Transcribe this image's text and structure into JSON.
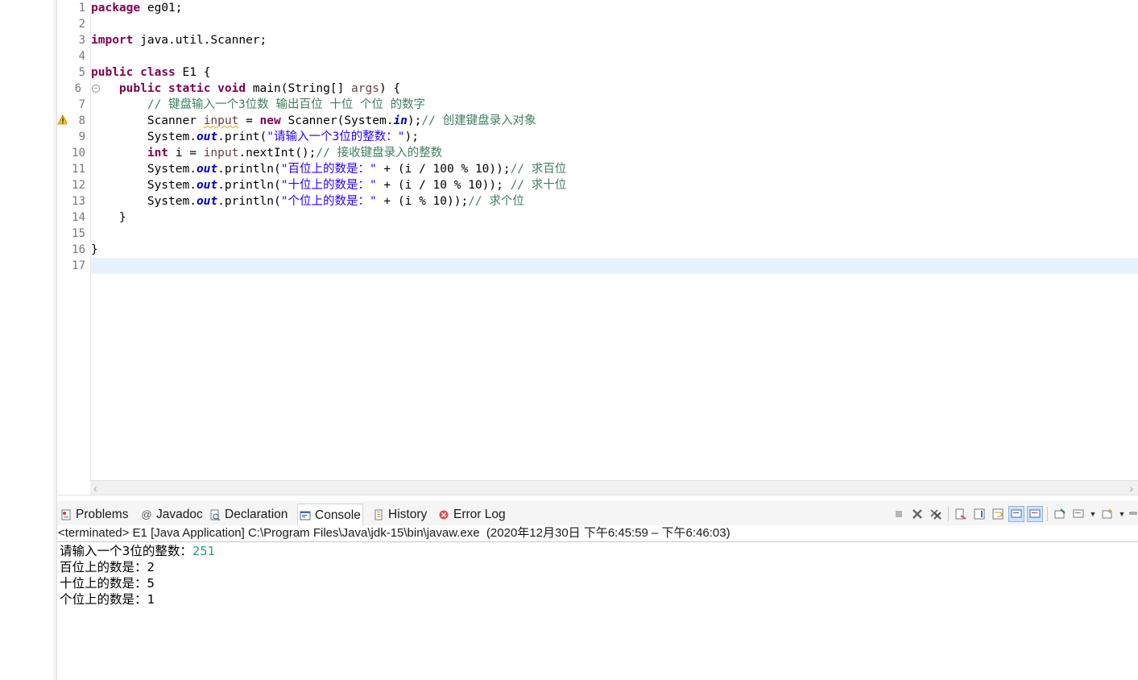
{
  "editor": {
    "line_numbers": [
      "1",
      "2",
      "3",
      "4",
      "5",
      "6",
      "7",
      "8",
      "9",
      "10",
      "11",
      "12",
      "13",
      "14",
      "15",
      "16",
      "17"
    ],
    "lines": {
      "l1": {
        "kw": "package",
        "rest": " eg01;"
      },
      "l3": {
        "kw": "import",
        "rest": " java.util.Scanner;"
      },
      "l5": {
        "kw1": "public",
        "kw2": "class",
        "rest": " E1 {"
      },
      "l6": {
        "indent": "    ",
        "kw1": "public",
        "kw2": "static",
        "kw3": "void",
        "rest1": " main(String[] ",
        "arg": "args",
        "rest2": ") {"
      },
      "l7": {
        "indent": "        ",
        "comment": "// 键盘输入一个3位数 输出百位 十位 个位 的数字"
      },
      "l8": {
        "indent": "        ",
        "t1": "Scanner ",
        "var": "input",
        "t2": " = ",
        "kw": "new",
        "t3": " Scanner(System.",
        "fld": "in",
        "t4": ");",
        "comment": "// 创建键盘录入对象"
      },
      "l9": {
        "indent": "        ",
        "t1": "System.",
        "fld": "out",
        "t2": ".print(",
        "str": "\"请输入一个3位的整数：\"",
        "t3": ");"
      },
      "l10": {
        "indent": "        ",
        "kw": "int",
        "t1": " i = ",
        "var": "input",
        "t2": ".nextInt();",
        "comment": "// 接收键盘录入的整数"
      },
      "l11": {
        "indent": "        ",
        "t1": "System.",
        "fld": "out",
        "t2": ".println(",
        "str": "\"百位上的数是：\"",
        "t3": " + (i / 100 % 10));",
        "comment": "// 求百位"
      },
      "l12": {
        "indent": "        ",
        "t1": "System.",
        "fld": "out",
        "t2": ".println(",
        "str": "\"十位上的数是：\"",
        "t3": " + (i / 10 % 10)); ",
        "comment": "// 求十位"
      },
      "l13": {
        "indent": "        ",
        "t1": "System.",
        "fld": "out",
        "t2": ".println(",
        "str": "\"个位上的数是：\"",
        "t3": " + (i % 10));",
        "comment": "// 求个位"
      },
      "l14": "    }",
      "l16": "}"
    }
  },
  "panel": {
    "tabs": [
      {
        "label": "Problems",
        "icon": "problems-icon"
      },
      {
        "label": "Javadoc",
        "icon": "at-icon"
      },
      {
        "label": "Declaration",
        "icon": "declaration-icon"
      },
      {
        "label": "Console",
        "icon": "console-icon",
        "active": true
      },
      {
        "label": "History",
        "icon": "history-icon"
      },
      {
        "label": "Error Log",
        "icon": "error-log-icon"
      }
    ],
    "console_header": "<terminated> E1 [Java Application] C:\\Program Files\\Java\\jdk-15\\bin\\javaw.exe  (2020年12月30日 下午6:45:59 – 下午6:46:03)",
    "output": {
      "prompt": "请输入一个3位的整数：",
      "input_value": "251",
      "line2": "百位上的数是：2",
      "line3": "十位上的数是：5",
      "line4": "个位上的数是：1"
    }
  },
  "colors": {
    "keyword": "#7f0055",
    "string": "#2a00ff",
    "comment": "#3f7f5f",
    "field": "#0000c0",
    "current_line": "#e8f2fe",
    "console_input": "#21a07a"
  }
}
